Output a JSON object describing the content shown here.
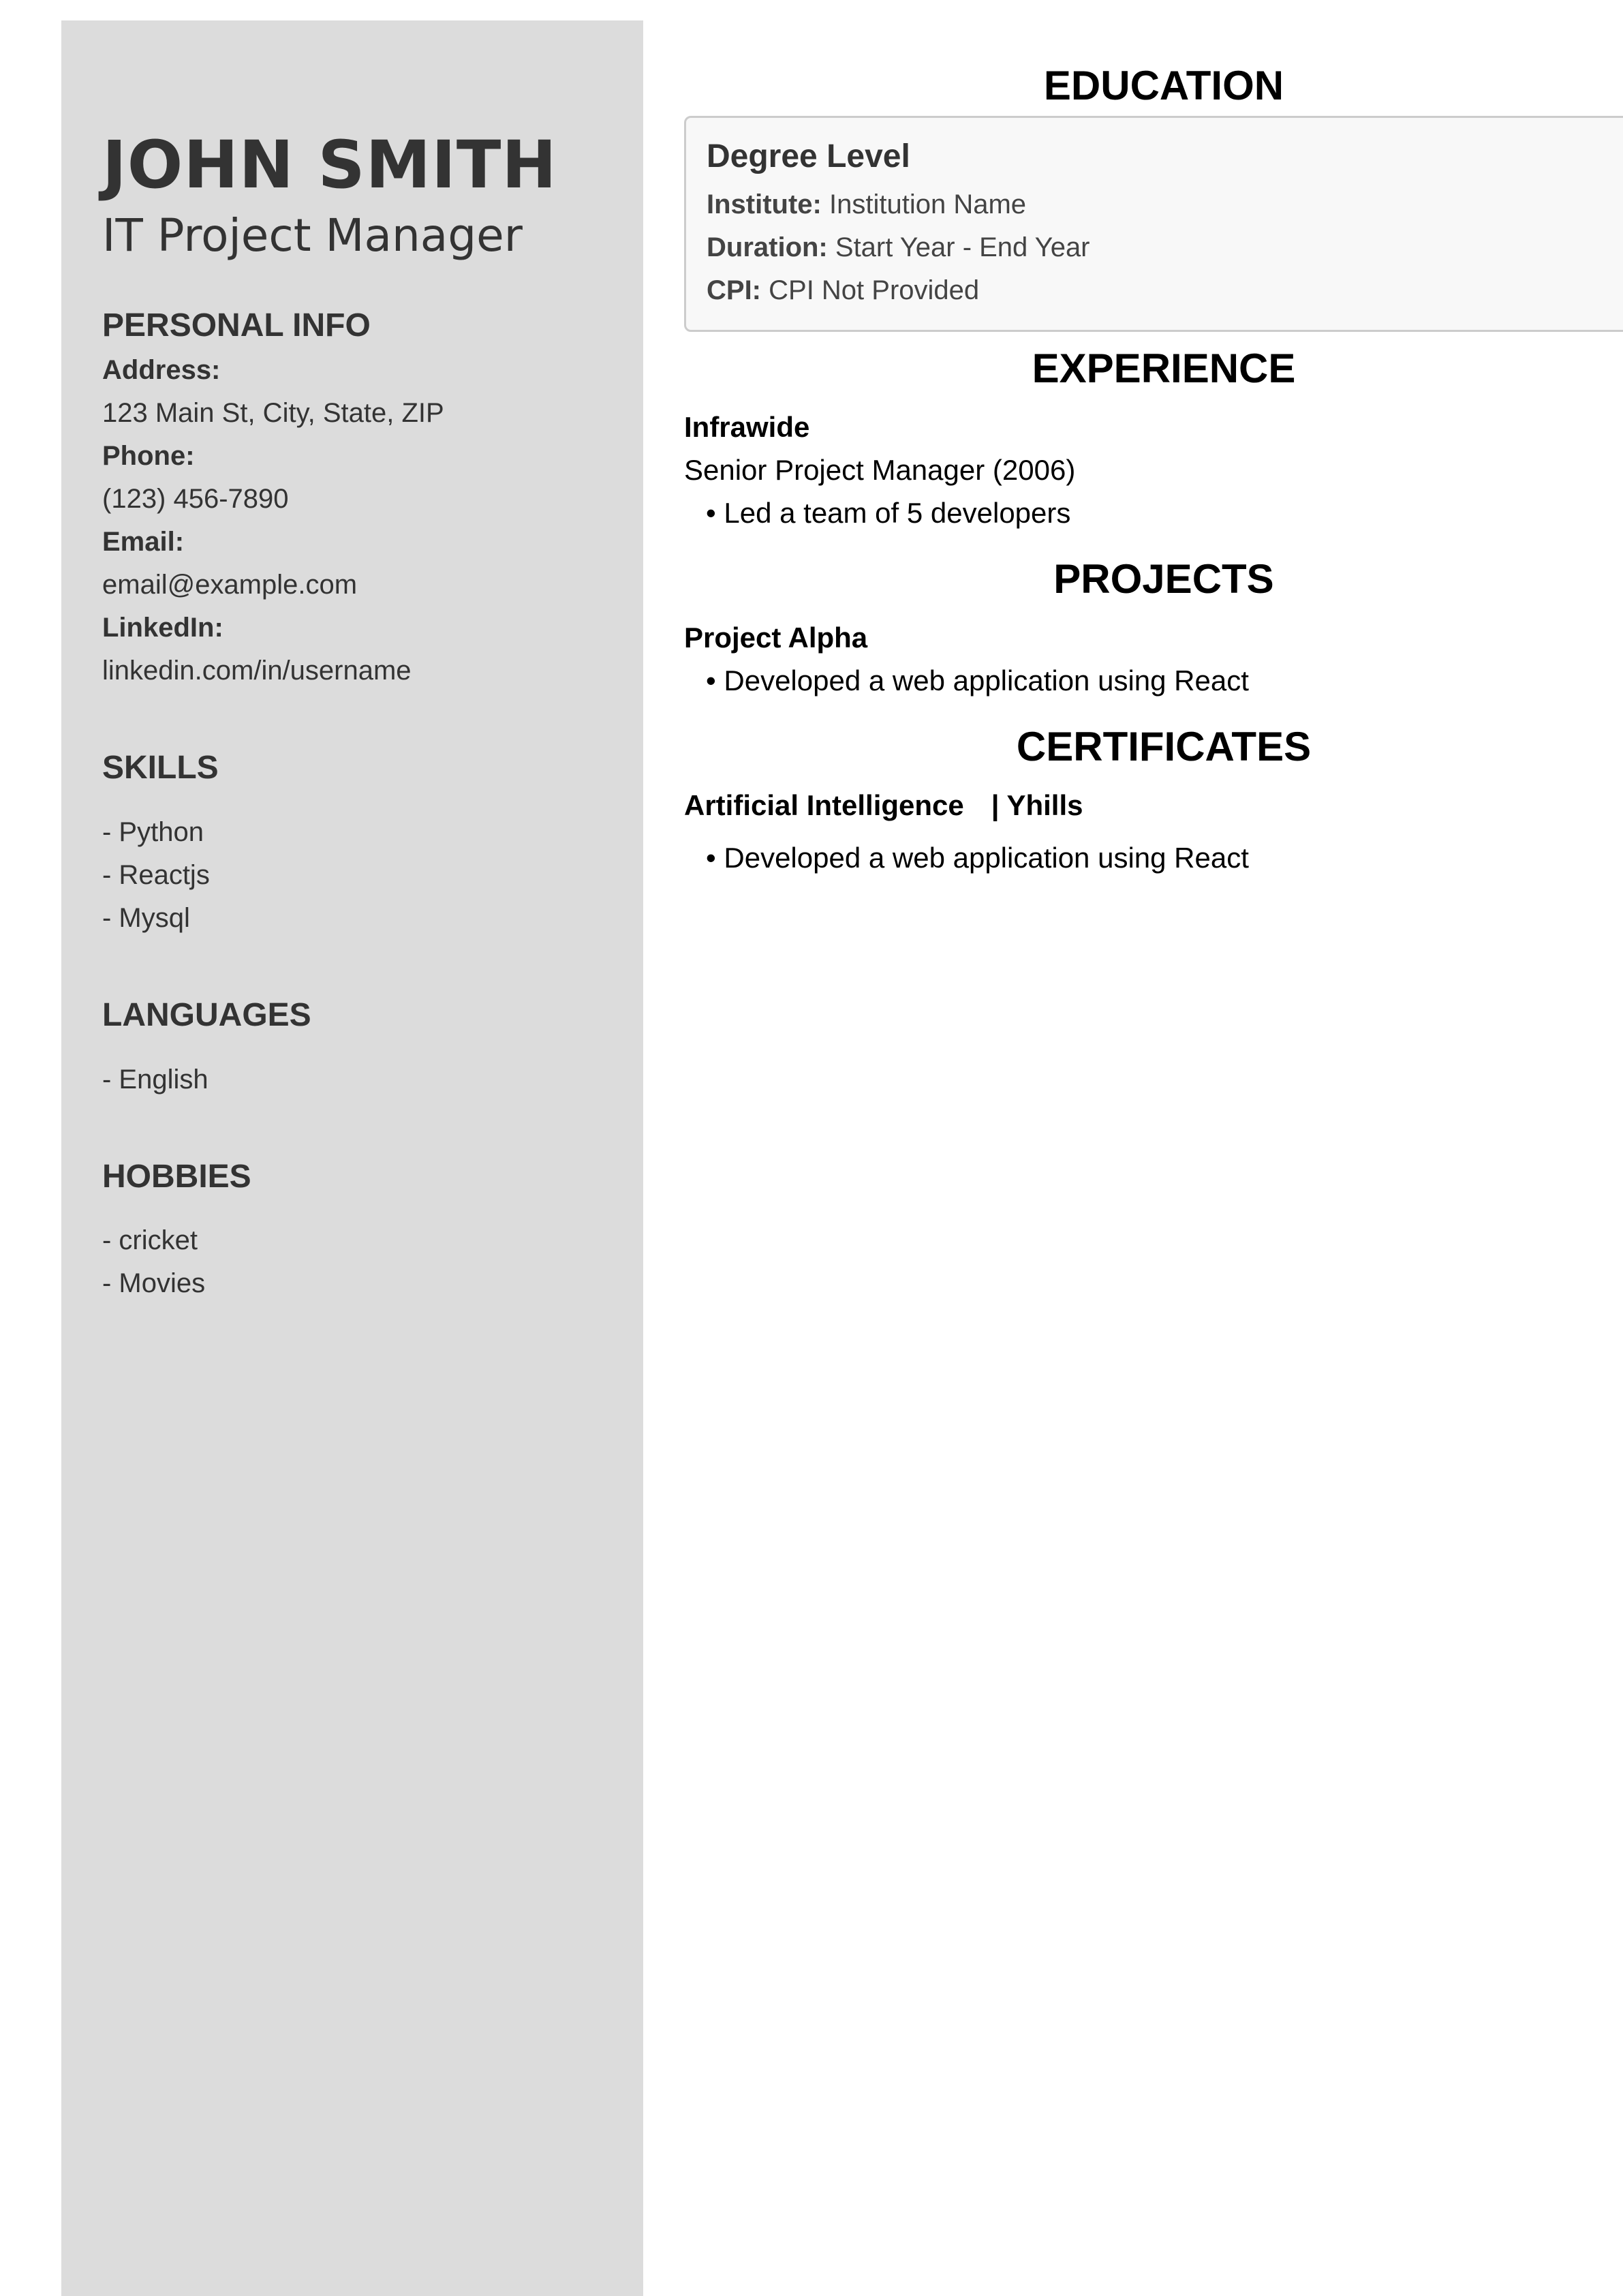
{
  "profile": {
    "name": "JOHN SMITH",
    "title": "IT Project Manager"
  },
  "personal_info": {
    "heading": "PERSONAL INFO",
    "items": [
      {
        "label": "Address:",
        "value": "123 Main St, City, State, ZIP"
      },
      {
        "label": "Phone:",
        "value": "(123) 456-7890"
      },
      {
        "label": "Email:",
        "value": "email@example.com"
      },
      {
        "label": "LinkedIn:",
        "value": "linkedin.com/in/username"
      }
    ]
  },
  "skills": {
    "heading": "SKILLS",
    "items": [
      "- Python",
      "- Reactjs",
      "- Mysql"
    ]
  },
  "languages": {
    "heading": "LANGUAGES",
    "items": [
      "- English"
    ]
  },
  "hobbies": {
    "heading": "HOBBIES",
    "items": [
      "- cricket",
      "- Movies"
    ]
  },
  "education": {
    "heading": "EDUCATION",
    "degree": "Degree Level",
    "institute_label": "Institute:",
    "institute": "Institution Name",
    "duration_label": "Duration:",
    "duration": "Start Year - End Year",
    "cpi_label": "CPI:",
    "cpi": "CPI Not Provided"
  },
  "experience": {
    "heading": "EXPERIENCE",
    "company": "Infrawide",
    "role": "Senior Project Manager (2006)",
    "bullets": [
      "• Led a team of 5 developers"
    ]
  },
  "projects": {
    "heading": "PROJECTS",
    "name": "Project Alpha",
    "bullets": [
      "• Developed a web application using React"
    ]
  },
  "certificates": {
    "heading": "CERTIFICATES",
    "name": "Artificial Intelligence",
    "issuer": "| Yhills",
    "bullets": [
      "• Developed a web application using React"
    ]
  }
}
